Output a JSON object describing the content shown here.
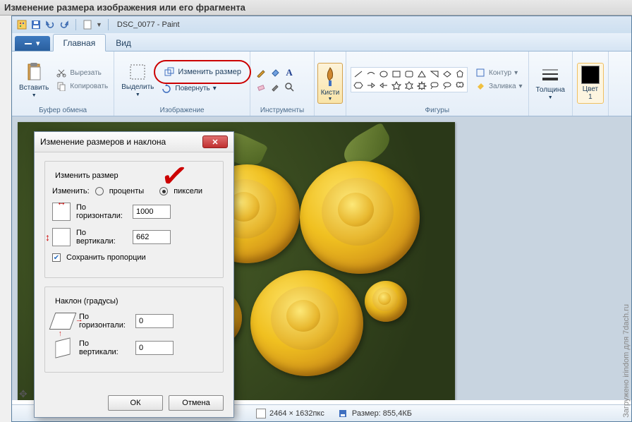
{
  "outer_title": "Изменение размера изображения или его фрагмента",
  "qat": {
    "doc_title": "DSC_0077 - Paint"
  },
  "tabs": {
    "home": "Главная",
    "view": "Вид"
  },
  "ribbon": {
    "clipboard": {
      "paste": "Вставить",
      "cut": "Вырезать",
      "copy": "Копировать",
      "group": "Буфер обмена"
    },
    "image": {
      "select": "Выделить",
      "resize": "Изменить размер",
      "rotate": "Повернуть",
      "group": "Изображение"
    },
    "tools": {
      "group": "Инструменты"
    },
    "brushes": {
      "label": "Кисти"
    },
    "shapes": {
      "outline": "Контур",
      "fill": "Заливка",
      "group": "Фигуры"
    },
    "thickness": "Толщина",
    "color1": "Цвет\n1"
  },
  "dialog": {
    "title": "Изменение размеров и наклона",
    "resize_group": "Изменить размер",
    "change_by": "Изменить:",
    "percent": "проценты",
    "pixels": "пиксели",
    "horizontal": "По горизонтали:",
    "vertical": "По вертикали:",
    "h_value": "1000",
    "v_value": "662",
    "keep_aspect": "Сохранить пропорции",
    "skew_group": "Наклон (градусы)",
    "skew_h": "0",
    "skew_v": "0",
    "ok": "ОК",
    "cancel": "Отмена"
  },
  "status": {
    "dimensions": "2464 × 1632пкс",
    "size_label": "Размер: 855,4КБ"
  },
  "watermark": "Загружено irindom для 7dach.ru"
}
